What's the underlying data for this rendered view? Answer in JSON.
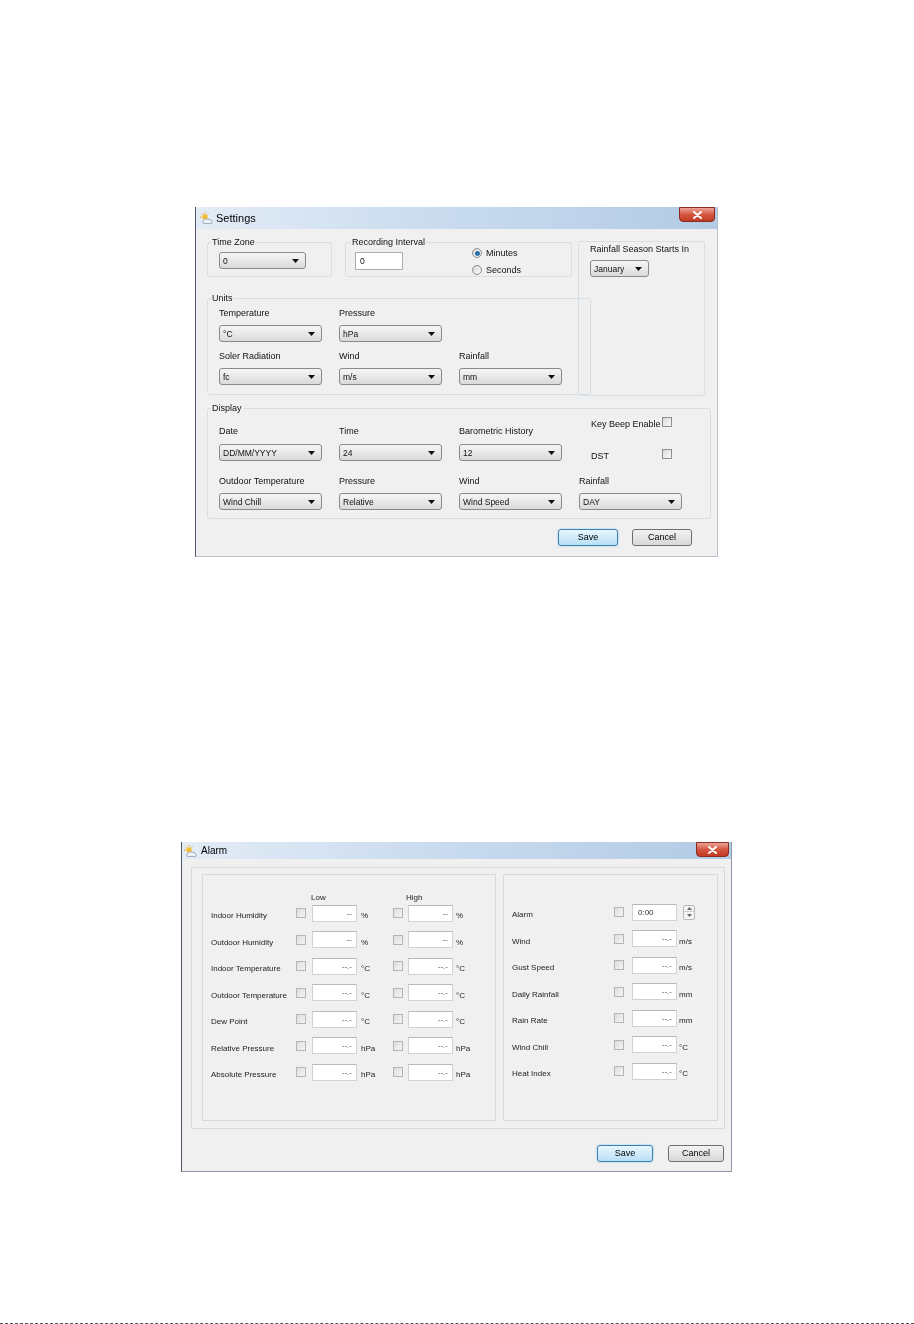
{
  "settings_dialog": {
    "title": "Settings",
    "time_zone": {
      "label": "Time Zone",
      "value": "0"
    },
    "recording_interval": {
      "label": "Recording Interval",
      "value": "0",
      "options": [
        {
          "label": "Minutes",
          "selected": true
        },
        {
          "label": "Seconds",
          "selected": false
        }
      ]
    },
    "rainfall_season": {
      "label": "Rainfall Season Starts In",
      "value": "January"
    },
    "units": {
      "label": "Units",
      "rows": [
        {
          "fields": [
            {
              "label": "Temperature",
              "value": "°C"
            },
            {
              "label": "Pressure",
              "value": "hPa"
            }
          ]
        },
        {
          "fields": [
            {
              "label": "Soler Radiation",
              "value": "fc"
            },
            {
              "label": "Wind",
              "value": "m/s"
            },
            {
              "label": "Rainfall",
              "value": "mm"
            }
          ]
        }
      ]
    },
    "display": {
      "label": "Display",
      "rows": [
        {
          "fields": [
            {
              "label": "Date",
              "value": "DD/MM/YYYY"
            },
            {
              "label": "Time",
              "value": "24"
            },
            {
              "label": "Barometric History",
              "value": "12"
            }
          ]
        },
        {
          "fields": [
            {
              "label": "Outdoor Temperature",
              "value": "Wind Chill"
            },
            {
              "label": "Pressure",
              "value": "Relative"
            },
            {
              "label": "Wind",
              "value": "Wind Speed"
            },
            {
              "label": "Rainfall",
              "value": "DAY"
            }
          ]
        }
      ],
      "toggles": [
        {
          "label": "Key Beep Enable",
          "checked": false
        },
        {
          "label": "DST",
          "checked": false
        }
      ]
    },
    "buttons": [
      {
        "label": "Save",
        "focused": true
      },
      {
        "label": "Cancel",
        "focused": false
      }
    ]
  },
  "alarm_dialog": {
    "title": "Alarm",
    "columns": [
      "Low",
      "High"
    ],
    "left_rows": [
      {
        "label": "Indoor Humidity",
        "low": {
          "checked": false,
          "value": "--",
          "unit": "%"
        },
        "high": {
          "checked": false,
          "value": "--",
          "unit": "%"
        }
      },
      {
        "label": "Outdoor Humidity",
        "low": {
          "checked": false,
          "value": "--",
          "unit": "%"
        },
        "high": {
          "checked": false,
          "value": "--",
          "unit": "%"
        }
      },
      {
        "label": "Indoor Temperature",
        "low": {
          "checked": false,
          "value": "--.-",
          "unit": "°C"
        },
        "high": {
          "checked": false,
          "value": "--.-",
          "unit": "°C"
        }
      },
      {
        "label": "Outdoor Temperature",
        "low": {
          "checked": false,
          "value": "--.-",
          "unit": "°C"
        },
        "high": {
          "checked": false,
          "value": "--.-",
          "unit": "°C"
        }
      },
      {
        "label": "Dew Point",
        "low": {
          "checked": false,
          "value": "--.-",
          "unit": "°C"
        },
        "high": {
          "checked": false,
          "value": "--.-",
          "unit": "°C"
        }
      },
      {
        "label": "Relative Pressure",
        "low": {
          "checked": false,
          "value": "--.-",
          "unit": "hPa"
        },
        "high": {
          "checked": false,
          "value": "--.-",
          "unit": "hPa"
        }
      },
      {
        "label": "Absolute Pressure",
        "low": {
          "checked": false,
          "value": "--.-",
          "unit": "hPa"
        },
        "high": {
          "checked": false,
          "value": "--.-",
          "unit": "hPa"
        }
      }
    ],
    "right_rows": [
      {
        "label": "Alarm",
        "kind": "spinner",
        "checked": false,
        "value": "0:00"
      },
      {
        "label": "Wind",
        "kind": "unit",
        "checked": false,
        "value": "--.-",
        "unit": "m/s"
      },
      {
        "label": "Gust Speed",
        "kind": "unit",
        "checked": false,
        "value": "--.-",
        "unit": "m/s"
      },
      {
        "label": "Daily Rainfall",
        "kind": "unit",
        "checked": false,
        "value": "--.-",
        "unit": "mm"
      },
      {
        "label": "Rain Rate",
        "kind": "unit",
        "checked": false,
        "value": "--.-",
        "unit": "mm"
      },
      {
        "label": "Wind Chill",
        "kind": "unit",
        "checked": false,
        "value": "--.-",
        "unit": "°C"
      },
      {
        "label": "Heat Index",
        "kind": "unit",
        "checked": false,
        "value": "--.-",
        "unit": "°C"
      }
    ],
    "buttons": [
      {
        "label": "Save",
        "focused": true
      },
      {
        "label": "Cancel",
        "focused": false
      }
    ]
  }
}
